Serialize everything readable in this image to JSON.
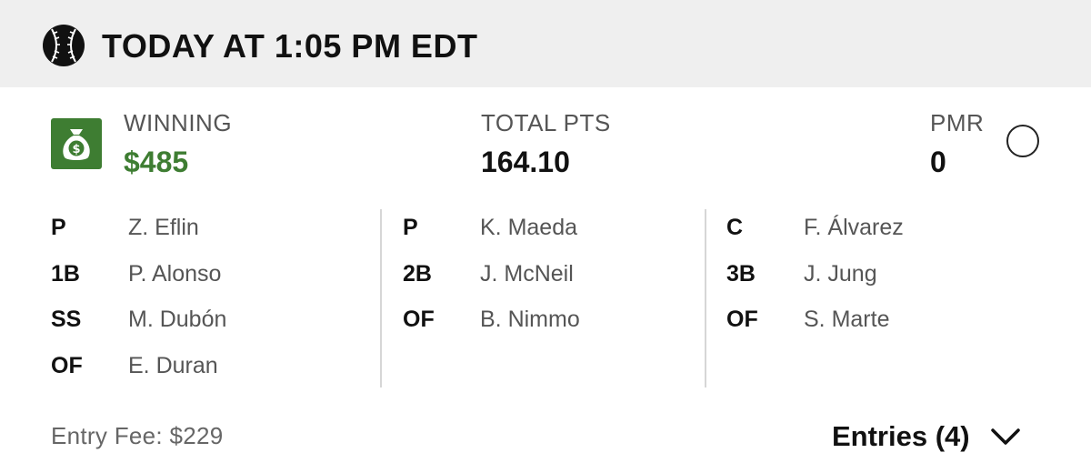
{
  "header": {
    "icon": "baseball-icon",
    "title": "TODAY AT 1:05 PM EDT"
  },
  "stats": {
    "winning": {
      "label": "WINNING",
      "value": "$485",
      "icon": "money-bag-icon",
      "color": "#3e7d32"
    },
    "total_pts": {
      "label": "TOTAL PTS",
      "value": "164.10"
    },
    "pmr": {
      "label": "PMR",
      "value": "0"
    }
  },
  "roster": {
    "columns": [
      [
        {
          "pos": "P",
          "player": "Z. Eflin"
        },
        {
          "pos": "1B",
          "player": "P. Alonso"
        },
        {
          "pos": "SS",
          "player": "M. Dubón"
        },
        {
          "pos": "OF",
          "player": "E. Duran"
        }
      ],
      [
        {
          "pos": "P",
          "player": "K. Maeda"
        },
        {
          "pos": "2B",
          "player": "J. McNeil"
        },
        {
          "pos": "OF",
          "player": "B. Nimmo"
        }
      ],
      [
        {
          "pos": "C",
          "player": "F. Álvarez"
        },
        {
          "pos": "3B",
          "player": "J. Jung"
        },
        {
          "pos": "OF",
          "player": "S. Marte"
        }
      ]
    ]
  },
  "footer": {
    "entry_fee": "Entry Fee: $229",
    "entries_label": "Entries (4)",
    "entries_icon": "chevron-down-icon"
  }
}
